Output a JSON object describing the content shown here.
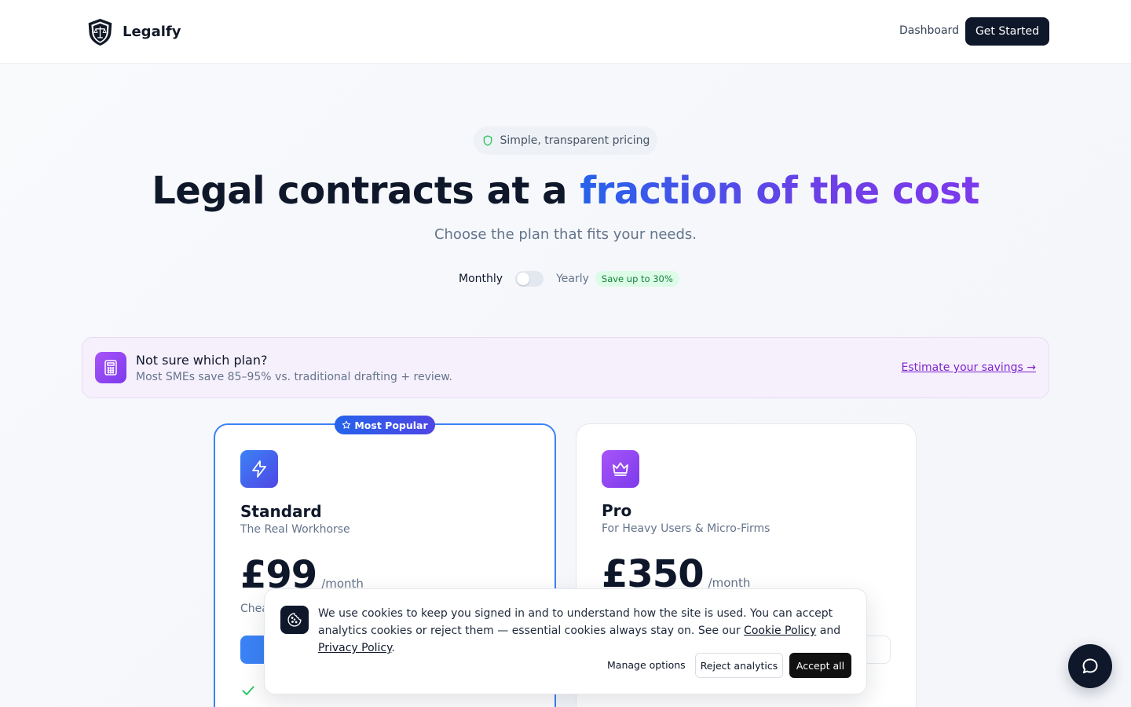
{
  "brand": {
    "name": "Legalfy"
  },
  "nav": {
    "dashboard": "Dashboard",
    "cta": "Get Started"
  },
  "hero": {
    "badge": "Simple, transparent pricing",
    "title_plain": "Legal contracts at a ",
    "title_highlight": "fraction of the cost",
    "subtitle": "Choose the plan that fits your needs."
  },
  "billing": {
    "monthly_label": "Monthly",
    "yearly_label": "Yearly",
    "save_badge": "Save up to 30%",
    "yearly_selected": false
  },
  "savings_banner": {
    "title": "Not sure which plan?",
    "description": "Most SMEs save 85–95% vs. traditional drafting + review.",
    "link": "Estimate your savings →"
  },
  "plans": [
    {
      "badge": "Most Popular",
      "name": "Standard",
      "tagline": "The Real Workhorse",
      "price": "£99",
      "period": "/month",
      "note": "Chea",
      "feature_partial": "·"
    },
    {
      "name": "Pro",
      "tagline": "For Heavy Users & Micro-Firms",
      "price": "£350",
      "period": "/month"
    }
  ],
  "cookie": {
    "text_before": "We use cookies to keep you signed in and to understand how the site is used. You can accept analytics cookies or reject them — essential cookies always stay on. See our ",
    "cookie_policy": "Cookie Policy",
    "and": " and ",
    "privacy_policy": "Privacy Policy",
    "period": ".",
    "manage": "Manage options",
    "reject": "Reject analytics",
    "accept": "Accept all"
  },
  "colors": {
    "primary": "#3b82f6",
    "dark": "#0f172a",
    "purple": "#7c3aed",
    "success": "#15803d"
  },
  "icons": {
    "logo": "shield-scales-icon",
    "badge": "shield-icon",
    "savings": "calculator-icon",
    "standard": "lightning-icon",
    "pro": "crown-icon",
    "popular": "star-icon",
    "cookie": "cookie-icon",
    "chat": "chat-bubble-icon",
    "feature": "check-icon"
  }
}
